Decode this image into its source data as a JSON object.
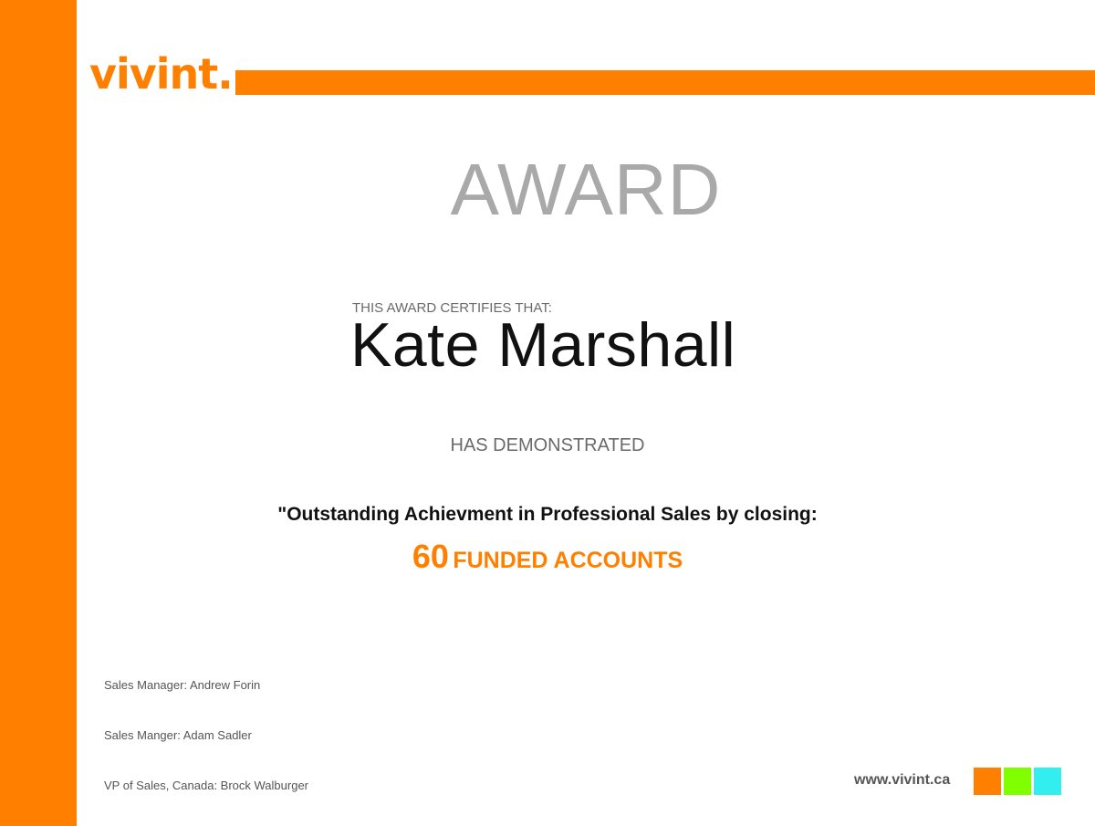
{
  "brand": {
    "logo_text": "vivint.",
    "website": "www.vivint.ca",
    "colors": {
      "primary": "#ff8000",
      "swatches": [
        "#ff8000",
        "#80ff00",
        "#33eeee"
      ]
    }
  },
  "certificate": {
    "title": "AWARD",
    "certifies_label": "THIS AWARD CERTIFIES THAT:",
    "recipient": "Kate Marshall",
    "demonstrated_label": "HAS DEMONSTRATED",
    "achievement": "\"Outstanding Achievment in Professional Sales by closing:",
    "count": "60",
    "count_label": "FUNDED ACCOUNTS"
  },
  "signatories": [
    "Sales Manager: Andrew Forin",
    "Sales Manger: Adam Sadler",
    "VP of Sales, Canada: Brock Walburger"
  ]
}
